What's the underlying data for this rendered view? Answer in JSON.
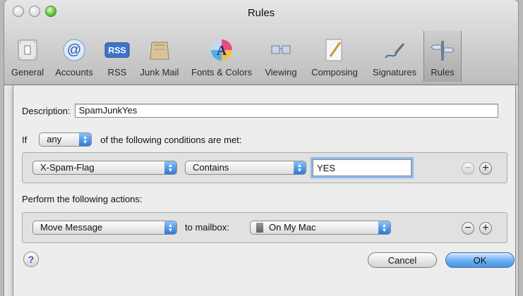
{
  "window": {
    "title": "Rules"
  },
  "toolbar": {
    "items": [
      {
        "label": "General",
        "icon": "general-switch-icon"
      },
      {
        "label": "Accounts",
        "icon": "at-sign-icon"
      },
      {
        "label": "RSS",
        "icon": "rss-badge-icon"
      },
      {
        "label": "Junk Mail",
        "icon": "junk-mail-icon"
      },
      {
        "label": "Fonts & Colors",
        "icon": "fonts-colors-icon"
      },
      {
        "label": "Viewing",
        "icon": "viewing-glasses-icon"
      },
      {
        "label": "Composing",
        "icon": "composing-pencil-icon"
      },
      {
        "label": "Signatures",
        "icon": "signature-pen-icon"
      },
      {
        "label": "Rules",
        "icon": "rules-signpost-icon"
      }
    ],
    "selected": "Rules"
  },
  "rule": {
    "description_label": "Description:",
    "description_value": "SpamJunkYes",
    "if_label": "If",
    "match_value": "any",
    "conditions_suffix": "of the following conditions are met:",
    "condition": {
      "header": "X-Spam-Flag",
      "operator": "Contains",
      "value": "YES"
    },
    "actions_label": "Perform the following actions:",
    "action": {
      "type": "Move Message",
      "to_label": "to mailbox:",
      "mailbox": "On My Mac"
    }
  },
  "buttons": {
    "help": "?",
    "cancel": "Cancel",
    "ok": "OK",
    "remove": "−",
    "add": "+"
  },
  "colors": {
    "accent": "#4c93e3",
    "help_glyph": "#7b3fb4"
  }
}
